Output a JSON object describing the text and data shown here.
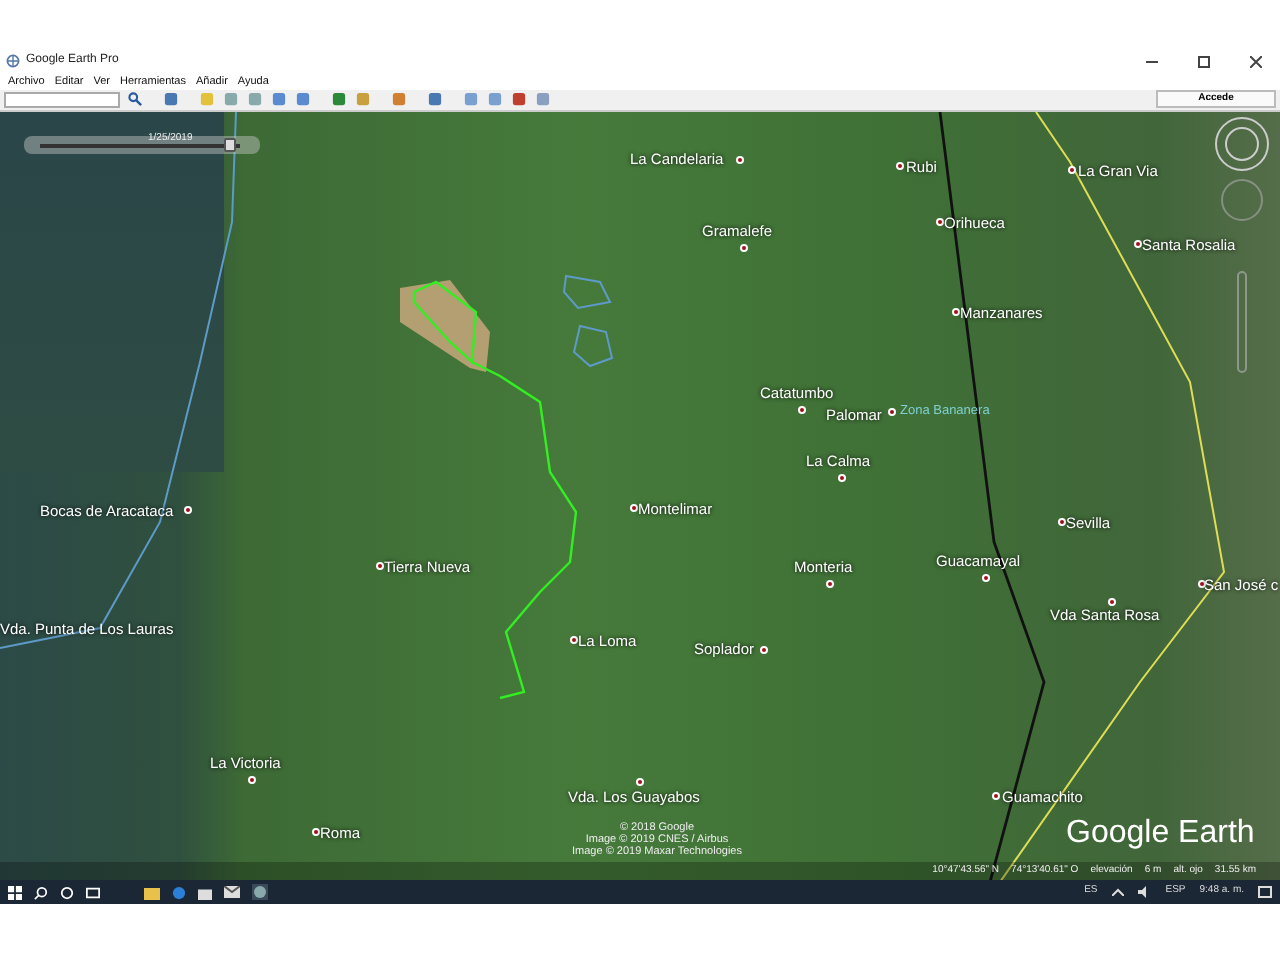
{
  "window": {
    "title": "Google Earth Pro"
  },
  "menu": [
    {
      "label": "Archivo"
    },
    {
      "label": "Editar"
    },
    {
      "label": "Ver"
    },
    {
      "label": "Herramientas"
    },
    {
      "label": "Añadir"
    },
    {
      "label": "Ayuda"
    }
  ],
  "toolbar": {
    "sign_in_button": "Accede"
  },
  "timeline": {
    "date": "1/25/2019",
    "level": 0.95
  },
  "map": {
    "places": [
      {
        "name": "La Candelaria"
      },
      {
        "name": "Rubi"
      },
      {
        "name": "Gramalefe"
      },
      {
        "name": "Orihueca"
      },
      {
        "name": "La Gran Via"
      },
      {
        "name": "Santa Rosalia"
      },
      {
        "name": "Manzanares"
      },
      {
        "name": "Catatumbo"
      },
      {
        "name": "Palomar"
      },
      {
        "name": "La Calma"
      },
      {
        "name": "Montelimar"
      },
      {
        "name": "Sevilla"
      },
      {
        "name": "Monteria"
      },
      {
        "name": "Guacamayal"
      },
      {
        "name": "San José c"
      },
      {
        "name": "Vda Santa Rosa"
      },
      {
        "name": "La Loma"
      },
      {
        "name": "Soplador"
      },
      {
        "name": "Bocas de Aracataca"
      },
      {
        "name": "Tierra Nueva"
      },
      {
        "name": "Vda. Punta de Los Lauras"
      },
      {
        "name": "La Victoria"
      },
      {
        "name": "Roma"
      },
      {
        "name": "Vda. Los Guayabos"
      },
      {
        "name": "Guamachito"
      }
    ],
    "region_label": "Zona Bananera",
    "attribution": [
      "© 2018 Google",
      "Image © 2019 CNES / Airbus",
      "Image © 2019 Maxar Technologies"
    ],
    "logo": "Google Earth"
  },
  "status_bar": {
    "latitude": "10°47'43.56\" N",
    "longitude": "74°13'40.61\" O",
    "elevation_label": "elevación",
    "elevation": "6 m",
    "eye_alt_label": "alt. ojo",
    "eye_alt": "31.55 km"
  },
  "taskbar": {
    "language": "ES",
    "keyboard": "ESP",
    "time": "9:48 a. m."
  }
}
